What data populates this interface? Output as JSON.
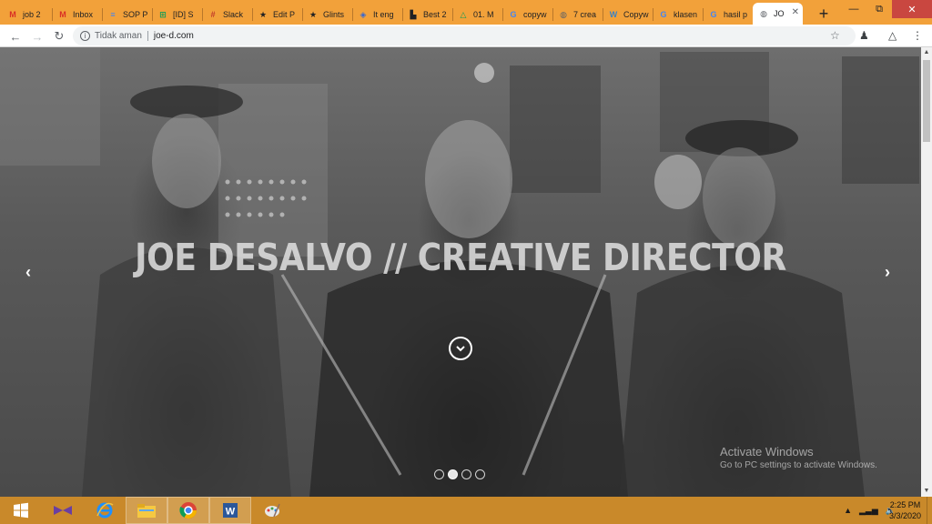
{
  "browser": {
    "tabs": [
      {
        "label": "job 2",
        "icon": "gmail-icon",
        "color": "#d93025"
      },
      {
        "label": "Inbox",
        "icon": "gmail-icon",
        "color": "#d93025"
      },
      {
        "label": "SOP P",
        "icon": "docs-icon",
        "color": "#4285f4"
      },
      {
        "label": "[ID] S",
        "icon": "sheets-icon",
        "color": "#0f9d58"
      },
      {
        "label": "Slack",
        "icon": "slack-icon",
        "color": "#c0392b"
      },
      {
        "label": "Edit P",
        "icon": "star-icon",
        "color": "#202124"
      },
      {
        "label": "Glints",
        "icon": "star-icon",
        "color": "#202124"
      },
      {
        "label": "It eng",
        "icon": "shield-icon",
        "color": "#3367d6"
      },
      {
        "label": "Best 2",
        "icon": "store-icon",
        "color": "#202124"
      },
      {
        "label": "01. M",
        "icon": "drive-icon",
        "color": "#0f9d58"
      },
      {
        "label": "copyw",
        "icon": "google-icon",
        "color": "#4285f4"
      },
      {
        "label": "7 crea",
        "icon": "globe-icon",
        "color": "#5f6368"
      },
      {
        "label": "Copyw",
        "icon": "w-icon",
        "color": "#3b82c4"
      },
      {
        "label": "klasen",
        "icon": "google-icon",
        "color": "#4285f4"
      },
      {
        "label": "hasil p",
        "icon": "google-icon",
        "color": "#4285f4"
      },
      {
        "label": "JO",
        "icon": "globe-icon",
        "color": "#5f6368",
        "active": true
      }
    ],
    "new_tab": "+",
    "address": {
      "security": "Tidak aman",
      "url": "joe-d.com"
    }
  },
  "page": {
    "hero_title": "JOE DESALVO // CREATIVE DIRECTOR",
    "prev_arrow": "‹",
    "next_arrow": "›",
    "slides": [
      {
        "active": false
      },
      {
        "active": true
      },
      {
        "active": false
      },
      {
        "active": false
      }
    ]
  },
  "watermark": {
    "line1": "Activate Windows",
    "line2": "Go to PC settings to activate Windows."
  },
  "taskbar": {
    "apps": [
      "windows-start-icon",
      "visual-studio-icon",
      "internet-explorer-icon",
      "file-explorer-icon",
      "chrome-icon",
      "word-icon",
      "paint-icon"
    ],
    "clock_time": "2:25 PM",
    "clock_date": "3/3/2020"
  }
}
